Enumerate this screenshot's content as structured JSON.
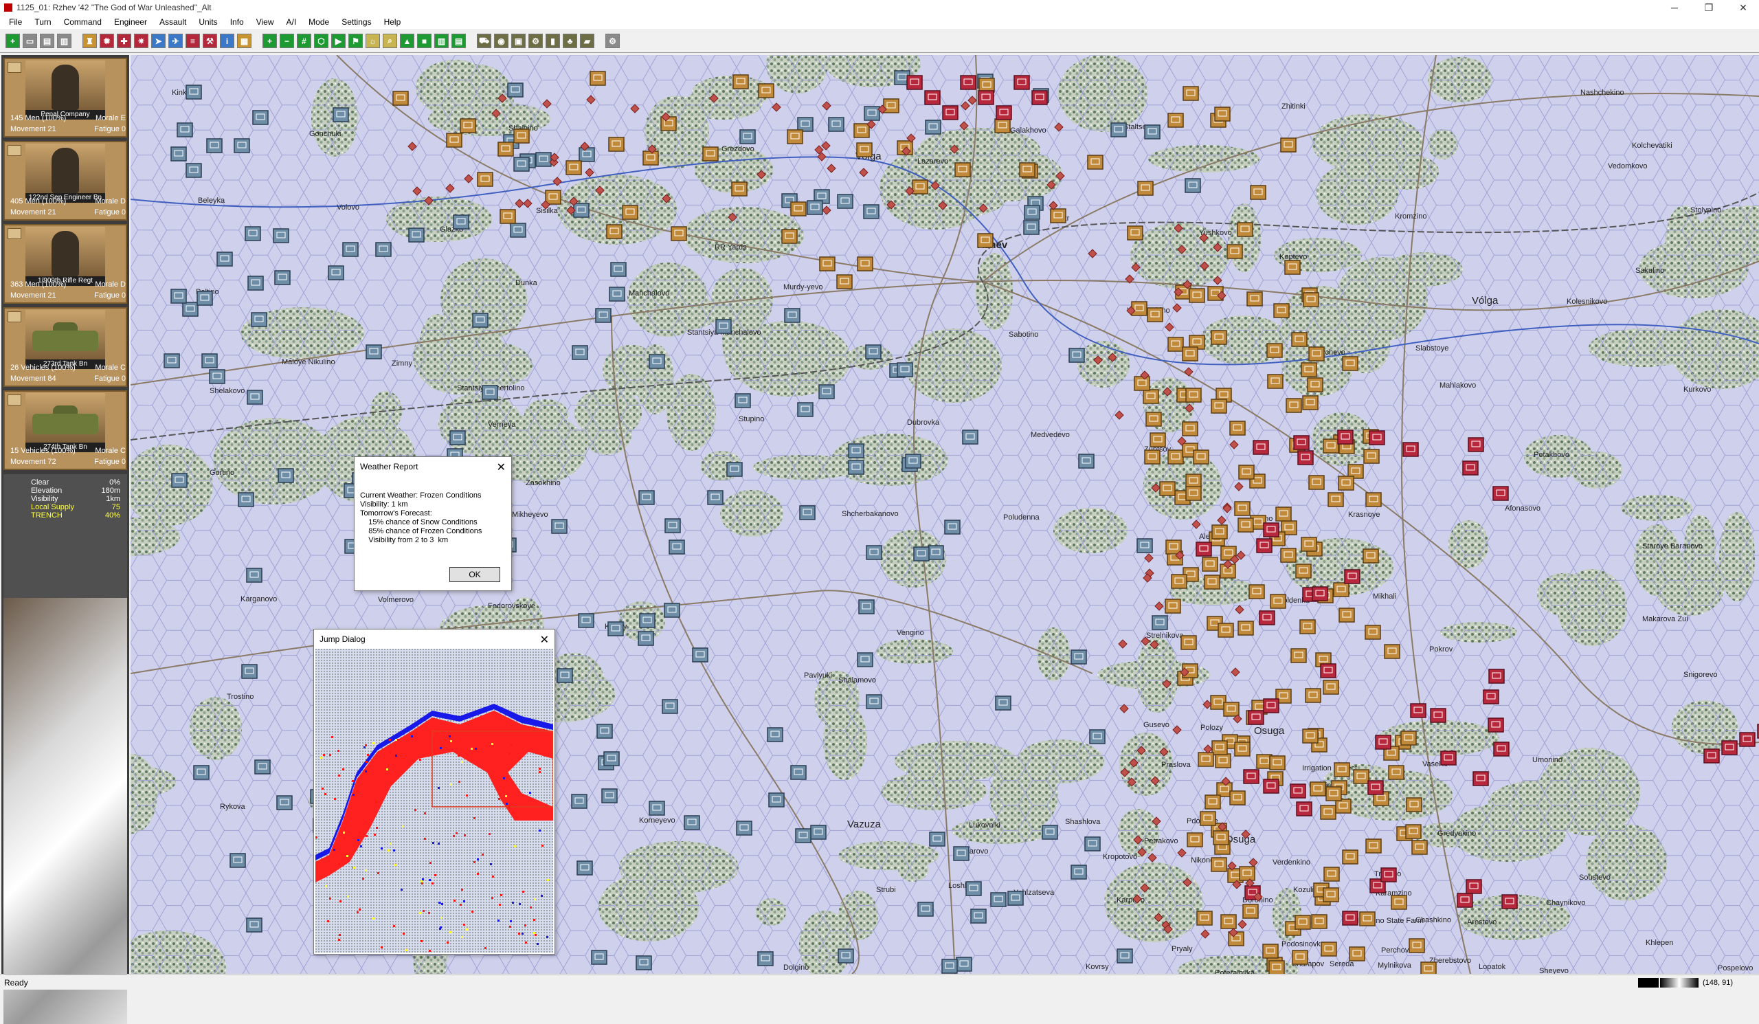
{
  "window": {
    "title": "1125_01: Rzhev '42 \"The God of War Unleashed\"_Alt",
    "controls": [
      "─",
      "❐",
      "✕"
    ]
  },
  "menu": [
    "File",
    "Turn",
    "Command",
    "Engineer",
    "Assault",
    "Units",
    "Info",
    "View",
    "A/I",
    "Mode",
    "Settings",
    "Help"
  ],
  "toolbar": {
    "buttons": [
      {
        "icon": "plus-circle-icon",
        "color": "#1e9a32"
      },
      {
        "icon": "map-icon",
        "color": "#8a8a8a"
      },
      {
        "icon": "open-icon",
        "color": "#8a8a8a"
      },
      {
        "icon": "save-icon",
        "color": "#8a8a8a"
      },
      {
        "icon": "unit-icon",
        "color": "#c89432"
      },
      {
        "icon": "attack-icon",
        "color": "#b4283c"
      },
      {
        "icon": "assault-icon",
        "color": "#b4283c"
      },
      {
        "icon": "artillery-icon",
        "color": "#b4283c"
      },
      {
        "icon": "move-icon",
        "color": "#3c78c8"
      },
      {
        "icon": "air-icon",
        "color": "#3c78c8"
      },
      {
        "icon": "stack-icon",
        "color": "#b4283c"
      },
      {
        "icon": "engineer-icon",
        "color": "#b4283c"
      },
      {
        "icon": "info-icon",
        "color": "#3c78c8"
      },
      {
        "icon": "report-icon",
        "color": "#c89432"
      },
      {
        "icon": "zoom-in-icon",
        "color": "#1e9a32"
      },
      {
        "icon": "zoom-out-icon",
        "color": "#1e9a32"
      },
      {
        "icon": "grid-icon",
        "color": "#1e9a32"
      },
      {
        "icon": "hex-icon",
        "color": "#1e9a32"
      },
      {
        "icon": "next-unit-icon",
        "color": "#1e9a32"
      },
      {
        "icon": "flag-icon",
        "color": "#1e9a32"
      },
      {
        "icon": "highlight-icon",
        "color": "#c8b450"
      },
      {
        "icon": "search-icon",
        "color": "#c8b450"
      },
      {
        "icon": "terrain-icon",
        "color": "#1e9a32"
      },
      {
        "icon": "vehicle-icon",
        "color": "#1e9a32"
      },
      {
        "icon": "book-icon",
        "color": "#1e9a32"
      },
      {
        "icon": "graph-icon",
        "color": "#1e9a32"
      },
      {
        "icon": "truck-icon",
        "color": "#6e6e46"
      },
      {
        "icon": "camera-icon",
        "color": "#6e6e46"
      },
      {
        "icon": "supply-icon",
        "color": "#6e6e46"
      },
      {
        "icon": "cog-icon",
        "color": "#6e6e46"
      },
      {
        "icon": "bar-icon",
        "color": "#6e6e46"
      },
      {
        "icon": "tree-icon",
        "color": "#6e6e46"
      },
      {
        "icon": "fortification-icon",
        "color": "#6e6e46"
      },
      {
        "icon": "settings-icon",
        "color": "#8a8a8a"
      }
    ]
  },
  "units": [
    {
      "name": "Penal Company",
      "line1_left": "145 Men (100%)",
      "line1_right": "Morale E",
      "line2_left": "Movement 21",
      "line2_right": "Fatigue 0",
      "kind": "soldier"
    },
    {
      "name": "122nd Sep Engineer Bn",
      "line1_left": "405 Men (100%)",
      "line1_right": "Morale D",
      "line2_left": "Movement 21",
      "line2_right": "Fatigue 0",
      "kind": "soldier"
    },
    {
      "name": "1/909th Rifle Regt",
      "line1_left": "363 Men (100%)",
      "line1_right": "Morale D",
      "line2_left": "Movement 21",
      "line2_right": "Fatigue 0",
      "kind": "soldier"
    },
    {
      "name": "273rd Tank Bn",
      "line1_left": "26 Vehicles (100%)",
      "line1_right": "Morale C",
      "line2_left": "Movement 84",
      "line2_right": "Fatigue 0",
      "kind": "tank"
    },
    {
      "name": "274th Tank Bn",
      "line1_left": "15 Vehicles (100%)",
      "line1_right": "Morale C",
      "line2_left": "Movement 72",
      "line2_right": "Fatigue 0",
      "kind": "tank"
    }
  ],
  "hex_status": [
    {
      "label": "Clear",
      "value": "0%"
    },
    {
      "label": "Elevation",
      "value": "180m"
    },
    {
      "label": "Visibility",
      "value": "1km"
    },
    {
      "label": "Local Supply",
      "value": "75"
    },
    {
      "label": "TRENCH",
      "value": "40%"
    }
  ],
  "weather_dialog": {
    "title": "Weather Report",
    "lines": [
      "Current Weather: Frozen Conditions",
      "Visibility: 1 km",
      "Tomorrow's Forecast:",
      "    15% chance of Snow Conditions",
      "    85% chance of Frozen Conditions",
      "    Visibility from 2 to 3  km"
    ],
    "ok_label": "OK"
  },
  "jump_dialog": {
    "title": "Jump Dialog"
  },
  "map": {
    "labels": [
      {
        "text": "Kinkovo"
      },
      {
        "text": "Gonchuki"
      },
      {
        "text": "Shalgino"
      },
      {
        "text": "Grezdovo"
      },
      {
        "text": "Volga"
      },
      {
        "text": "Lazarevo"
      },
      {
        "text": "Galakhovo"
      },
      {
        "text": "Staltsevo"
      },
      {
        "text": "Zhitinki"
      },
      {
        "text": "Nashchekino"
      },
      {
        "text": "Kolchevatiki"
      },
      {
        "text": "Vedomkovo"
      },
      {
        "text": "Beleyka"
      },
      {
        "text": "Volovo"
      },
      {
        "text": "Sisilka"
      },
      {
        "text": "Glazko"
      },
      {
        "text": "RR Yards"
      },
      {
        "text": "Rzhev"
      },
      {
        "text": "Aprkr"
      },
      {
        "text": "Yushkovo"
      },
      {
        "text": "Kromzino"
      },
      {
        "text": "Stolypino"
      },
      {
        "text": "Koptevo"
      },
      {
        "text": "Sakulino"
      },
      {
        "text": "Poltino"
      },
      {
        "text": "Dunka"
      },
      {
        "text": "Manchalovo"
      },
      {
        "text": "Murdy-yevo"
      },
      {
        "text": "Kolesnikovo"
      },
      {
        "text": "Vólga"
      },
      {
        "text": "Stantsiya Manchalovo"
      },
      {
        "text": "Sabotino"
      },
      {
        "text": "Vaguyushino"
      },
      {
        "text": "Brychevo"
      },
      {
        "text": "Slabstoye"
      },
      {
        "text": "Maloye Nikulino"
      },
      {
        "text": "Zimny"
      },
      {
        "text": "Stantsiya Chertolino"
      },
      {
        "text": "Shelakovo"
      },
      {
        "text": "Mahlakovo"
      },
      {
        "text": "Kurkovo"
      },
      {
        "text": "Verneya"
      },
      {
        "text": "Stupino"
      },
      {
        "text": "Dubrovka"
      },
      {
        "text": "Medvedevo"
      },
      {
        "text": "Zubtsov"
      },
      {
        "text": "Potakhovo"
      },
      {
        "text": "Gortino"
      },
      {
        "text": "Sokhotino"
      },
      {
        "text": "Zasokhino"
      },
      {
        "text": "Tapino"
      },
      {
        "text": "Krasnoye"
      },
      {
        "text": "Afonasovo"
      },
      {
        "text": "Mikheyevo"
      },
      {
        "text": "Shcherbakanovo"
      },
      {
        "text": "Poludenna"
      },
      {
        "text": "Alenino"
      },
      {
        "text": "Staroye Baranovo"
      },
      {
        "text": "Karganovo"
      },
      {
        "text": "Volmerovo"
      },
      {
        "text": "Fedorovskoye"
      },
      {
        "text": "Poldenka"
      },
      {
        "text": "Mikhali"
      },
      {
        "text": "Makarova Zui"
      },
      {
        "text": "Klintsy"
      },
      {
        "text": "Vengino"
      },
      {
        "text": "Strelnikova"
      },
      {
        "text": "Pokrov"
      },
      {
        "text": "Pavlyuki"
      },
      {
        "text": "Shalamovo"
      },
      {
        "text": "Snigorevo"
      },
      {
        "text": "Trostino"
      },
      {
        "text": "Gusevo"
      },
      {
        "text": "Polozy"
      },
      {
        "text": "Rykova"
      },
      {
        "text": "Osuga"
      },
      {
        "text": "Praslova"
      },
      {
        "text": "Irrigation Project"
      },
      {
        "text": "Korneyevo"
      },
      {
        "text": "Vazuza"
      },
      {
        "text": "Pdolubye"
      },
      {
        "text": "Vasel'ki"
      },
      {
        "text": "Osuga"
      },
      {
        "text": "Umonino"
      },
      {
        "text": "Dobrino"
      },
      {
        "text": "Gredyakino"
      },
      {
        "text": "Lukovniki"
      },
      {
        "text": "Shashlova"
      },
      {
        "text": "Petrakovo"
      },
      {
        "text": "Verdenkino"
      },
      {
        "text": "Trostino"
      },
      {
        "text": "Soustevo"
      },
      {
        "text": "Azarovo"
      },
      {
        "text": "Kropotovo"
      },
      {
        "text": "Nikonovo"
      },
      {
        "text": "Kozulino"
      },
      {
        "text": "Karamzino"
      },
      {
        "text": "Chaynikovo"
      },
      {
        "text": "Loshki"
      },
      {
        "text": "Strubi"
      },
      {
        "text": "Yahlzatseva"
      },
      {
        "text": "Karpovo"
      },
      {
        "text": "Doronino"
      },
      {
        "text": "Nikishino State Farm"
      },
      {
        "text": "Arestovo"
      },
      {
        "text": "Pryaly"
      },
      {
        "text": "Perchovo"
      },
      {
        "text": "Chashkino"
      },
      {
        "text": "Podosinovka"
      },
      {
        "text": "Sereda"
      },
      {
        "text": "Poteralovka"
      },
      {
        "text": "Zherebstovo"
      },
      {
        "text": "Khlepen"
      },
      {
        "text": "Pospelovo"
      },
      {
        "text": "Lopatok"
      },
      {
        "text": "Dolgino"
      },
      {
        "text": "Kovrsy"
      },
      {
        "text": "Sharapov"
      },
      {
        "text": "Mylnikova"
      },
      {
        "text": "Sheyevo"
      }
    ]
  },
  "statusbar": {
    "ready": "Ready",
    "coords": "(148, 91)"
  },
  "colors": {
    "german_counter": "#6e8ea8",
    "soviet_counter": "#c08a3a",
    "soviet_hq": "#b8283c",
    "map_background": "#cfd0ec",
    "forest": "#7a8a6a"
  }
}
